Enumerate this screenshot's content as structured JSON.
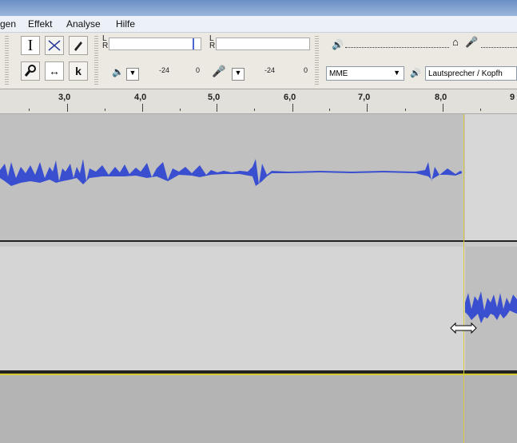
{
  "menu": {
    "items": [
      "gen",
      "Effekt",
      "Analyse",
      "Hilfe"
    ]
  },
  "tools": {
    "select": "I",
    "envelope": "envelope",
    "draw": "pencil",
    "zoom": "zoom",
    "timeshift": "↔",
    "multi": "*",
    "timeshift_highlight": "red-circle"
  },
  "meters": {
    "L": "L",
    "R": "R",
    "play_scale": [
      "-24",
      "0"
    ],
    "rec_scale": [
      "-24",
      "0"
    ]
  },
  "device": {
    "host": "MME",
    "output": "Lautsprecher / Kopfh"
  },
  "ruler": {
    "labels": [
      "3,0",
      "4,0",
      "5,0",
      "6,0",
      "7,0",
      "8,0",
      "9"
    ]
  },
  "colors": {
    "waveform": "#3a4fd0",
    "cursor": "#d6cc3a",
    "highlight": "#e0141e"
  }
}
